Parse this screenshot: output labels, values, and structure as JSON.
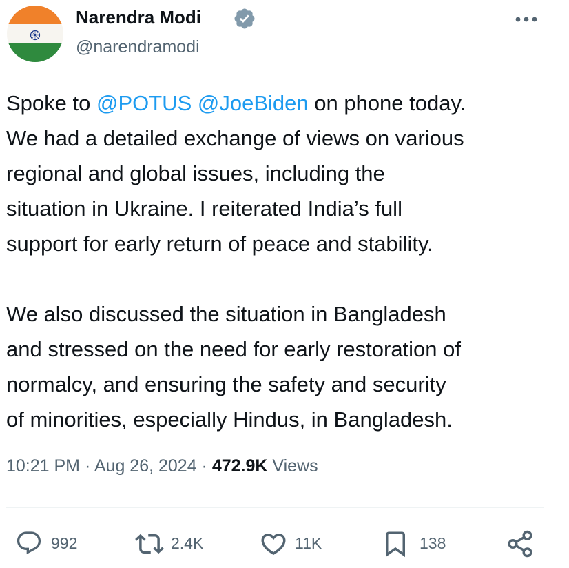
{
  "author": {
    "display_name": "Narendra Modi",
    "handle": "@narendramodi",
    "verified_icon": "verified-badge-icon",
    "avatar": "indian-flag-avatar"
  },
  "tweet": {
    "p1_a": "Spoke to ",
    "mention_1": "@POTUS",
    "p1_space": " ",
    "mention_2": "@JoeBiden",
    "p1_b": " on phone today.\nWe had a detailed exchange of views on various\nregional and global issues, including the\nsituation in Ukraine. I reiterated India’s full\nsupport for early return of peace and stability.\n\nWe also discussed the situation in Bangladesh\nand stressed on the need for early restoration of\nnormalcy, and ensuring the safety and security\nof minorities, especially Hindus, in Bangladesh."
  },
  "meta": {
    "time": "10:21 PM",
    "separator": " · ",
    "date": "Aug 26, 2024",
    "views_count": "472.9K",
    "views_label": " Views"
  },
  "actions": {
    "replies": "992",
    "reposts": "2.4K",
    "likes": "11K",
    "bookmarks": "138"
  },
  "colors": {
    "link": "#1d9bf0",
    "secondary_text": "#536471",
    "primary_text": "#0f1419",
    "verified": "#829aab"
  }
}
